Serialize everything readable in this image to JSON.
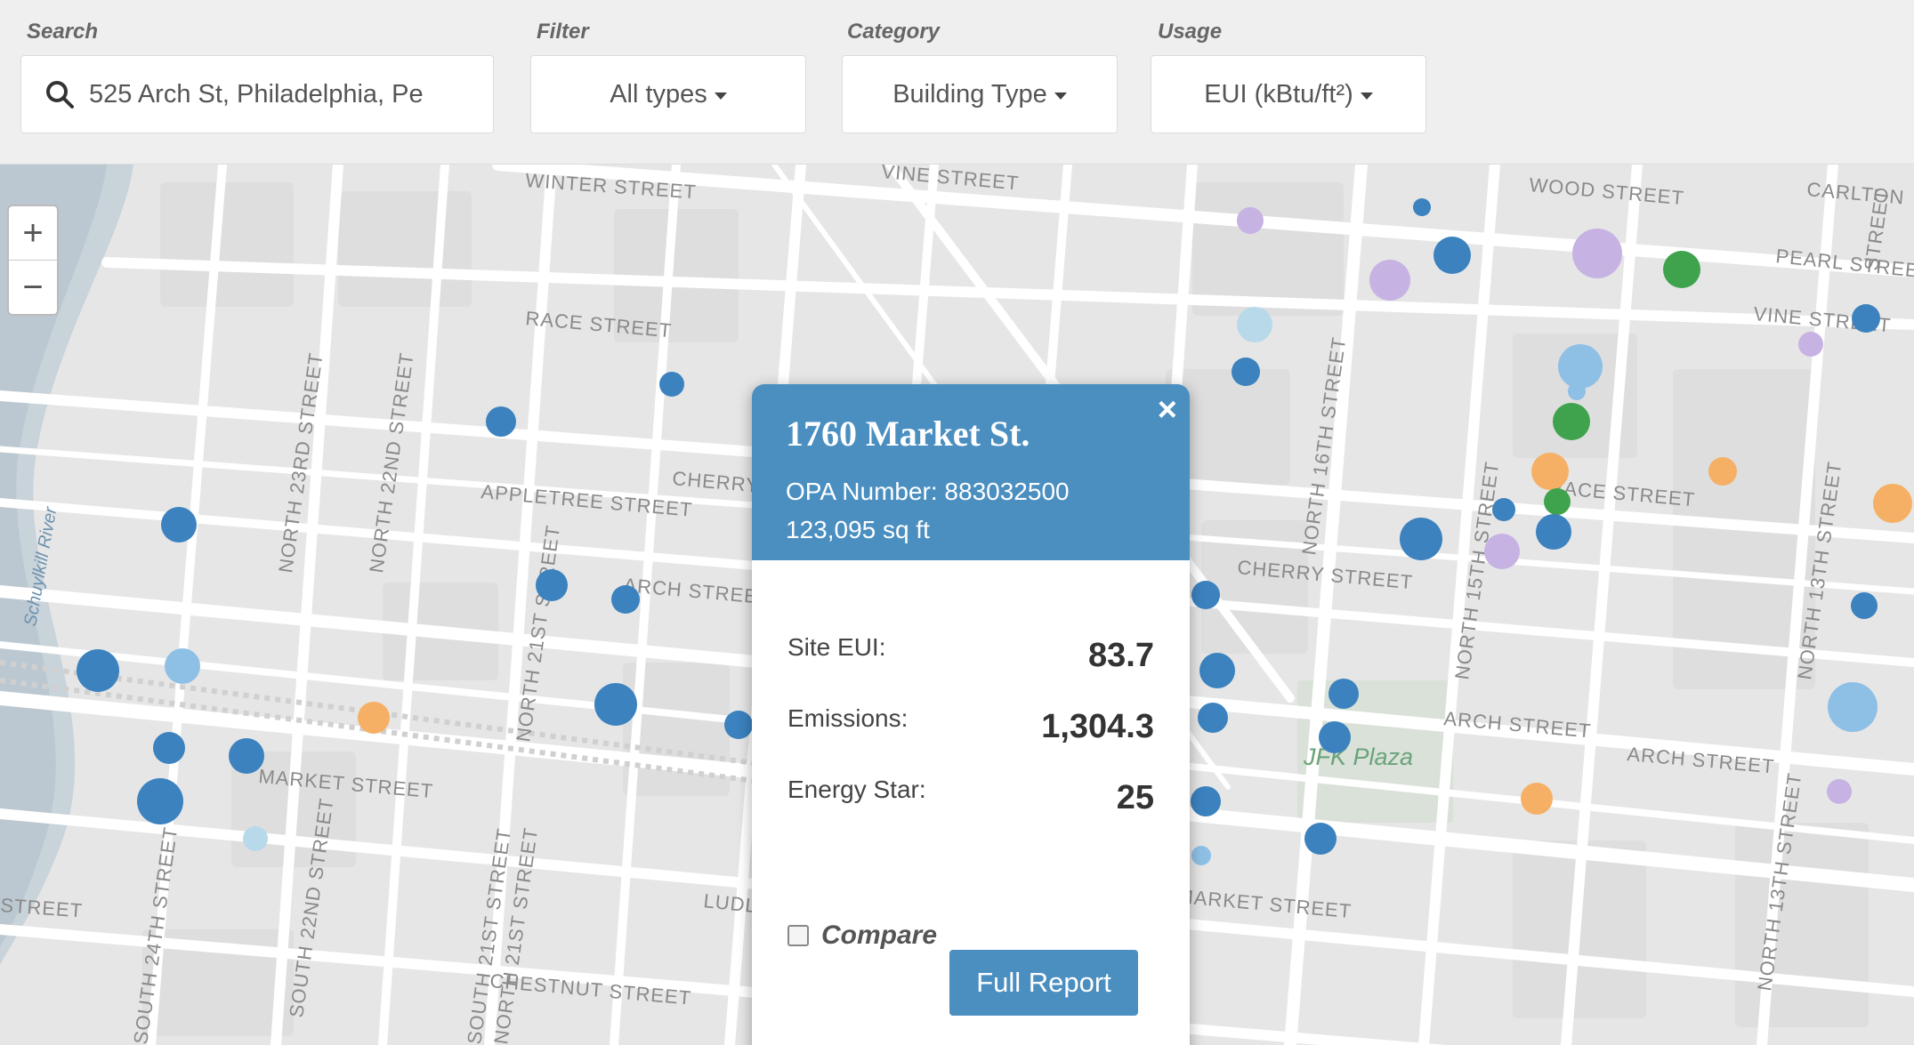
{
  "search": {
    "label": "Search",
    "value": "525 Arch St, Philadelphia, Pe"
  },
  "filter": {
    "label": "Filter",
    "value": "All types"
  },
  "category": {
    "label": "Category",
    "value": "Building Type"
  },
  "usage": {
    "label": "Usage",
    "value": "EUI (kBtu/ft²)"
  },
  "zoom": {
    "in": "+",
    "out": "−"
  },
  "colors": {
    "blue": "#3b82bf",
    "light_blue": "#8ec0e6",
    "pale_blue": "#b8d9ea",
    "green": "#3fa34d",
    "light_green": "#a6d68a",
    "orange": "#f5b065",
    "purple": "#c6b2e3",
    "red": "#e03c3c",
    "popup_header": "#4b8fc1"
  },
  "map": {
    "streets": [
      "WINTER STREET",
      "VINE STREET",
      "WOOD STREET",
      "CARLTON",
      "PEARL STREET",
      "VINE STREET",
      "RACE STREET",
      "RACE STREET",
      "CHERRY",
      "APPLETREE STREET",
      "ARCH STREET",
      "CHERRY STREET",
      "ARCH STREET",
      "ARCH STREET",
      "MARKET STREET",
      "MARKET STREET",
      "LUDLOW STREET",
      "CHESTNUT STREET",
      "STREET",
      "NORTH 23RD STREET",
      "NORTH 22ND STREET",
      "NORTH 21ST STREET",
      "NORTH 21ST STREET",
      "NORTH 16TH STREET",
      "NORTH 15TH STREET",
      "NORTH 13TH STREET",
      "NORTH 13TH STREET",
      "SOUTH 24TH STREET",
      "SOUTH 22ND STREET",
      "SOUTH 21ST STREET",
      "STREET"
    ],
    "places": [
      "JFK Plaza"
    ],
    "river": "Schuylkill River"
  },
  "popup": {
    "title": "1760 Market St.",
    "opa": "OPA Number: 883032500",
    "area": "123,095 sq ft",
    "close": "×",
    "stats": [
      {
        "label": "Site EUI:",
        "value": "83.7"
      },
      {
        "label": "Emissions:",
        "value": "1,304.3"
      },
      {
        "label": "Energy Star:",
        "value": "25"
      }
    ],
    "compare_label": "Compare",
    "report_label": "Full Report"
  }
}
